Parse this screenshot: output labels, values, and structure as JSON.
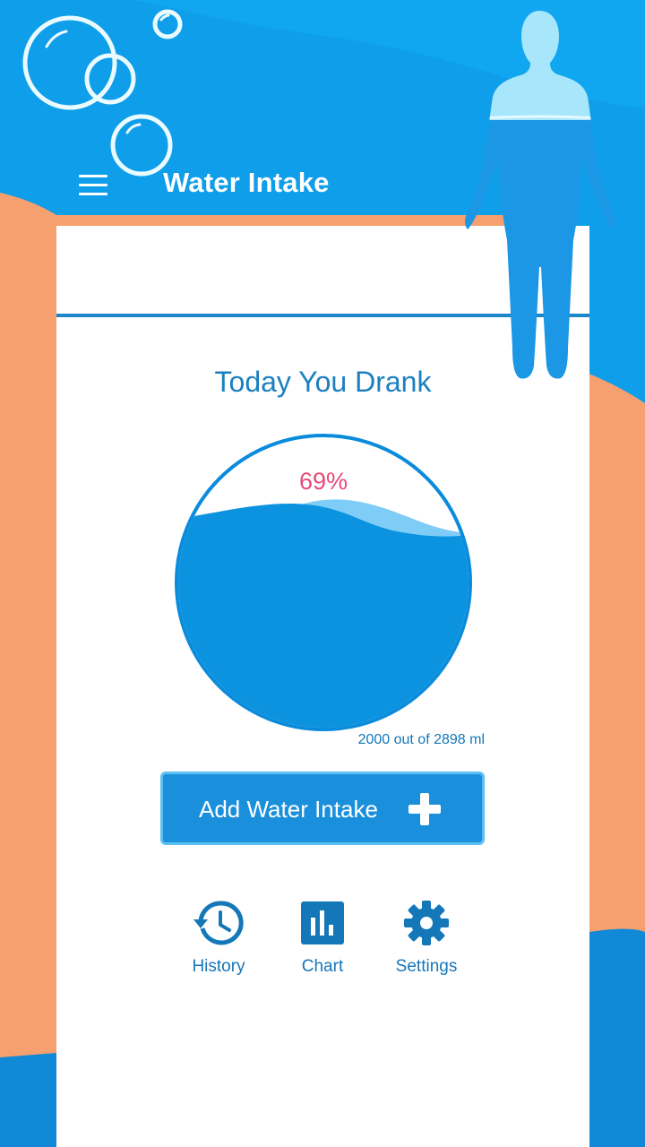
{
  "header": {
    "title": "Water Intake",
    "menu_icon": "hamburger-menu-icon"
  },
  "main": {
    "heading": "Today You Drank",
    "progress": {
      "percent_label": "69%",
      "fraction": 0.69,
      "amount_text": "2000 out of 2898 ml"
    },
    "add_button": {
      "label": "Add Water Intake",
      "icon": "plus-icon"
    },
    "nav": [
      {
        "label": "History",
        "icon": "history-icon"
      },
      {
        "label": "Chart",
        "icon": "bar-chart-icon"
      },
      {
        "label": "Settings",
        "icon": "gear-icon"
      }
    ]
  },
  "colors": {
    "header_blue": "#0f9ee9",
    "accent_blue": "#1a8fdc",
    "text_blue": "#1b7fc0",
    "percent_pink": "#e8497a",
    "background_orange": "#f6a06f"
  }
}
